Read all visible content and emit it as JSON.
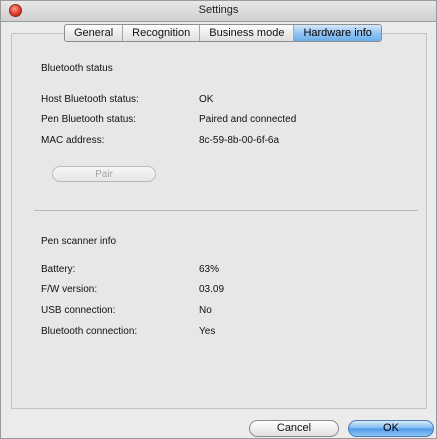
{
  "window": {
    "title": "Settings"
  },
  "tabs": [
    {
      "label": "General"
    },
    {
      "label": "Recognition"
    },
    {
      "label": "Business mode"
    },
    {
      "label": "Hardware info"
    }
  ],
  "bluetooth": {
    "section_title": "Bluetooth status",
    "rows": [
      {
        "label": "Host Bluetooth status:",
        "value": "OK"
      },
      {
        "label": "Pen Bluetooth status:",
        "value": "Paired and connected"
      },
      {
        "label": "MAC address:",
        "value": "8c-59-8b-00-6f-6a"
      }
    ],
    "pair_label": "Pair"
  },
  "pen": {
    "section_title": "Pen scanner info",
    "rows": [
      {
        "label": "Battery:",
        "value": "63%"
      },
      {
        "label": "F/W version:",
        "value": "03.09"
      },
      {
        "label": "USB connection:",
        "value": "No"
      },
      {
        "label": "Bluetooth connection:",
        "value": "Yes"
      }
    ]
  },
  "footer": {
    "cancel_label": "Cancel",
    "ok_label": "OK"
  },
  "colors": {
    "active_tab": "#8fc2f3",
    "ok_button": "#4f98e4",
    "close_button": "#e23a2a"
  },
  "icons": [
    "close-icon"
  ]
}
